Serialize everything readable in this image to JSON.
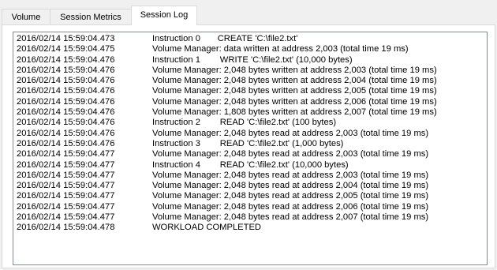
{
  "tabs": [
    "Volume",
    "Session Metrics",
    "Session Log"
  ],
  "active_tab": "Session Log",
  "log": [
    {
      "ts": "2016/02/14 15:59:04.473",
      "msg": "Instruction 0       CREATE 'C:\\file2.txt'"
    },
    {
      "ts": "2016/02/14 15:59:04.475",
      "msg": "Volume Manager: data written at address 2,003 (total time 19 ms)"
    },
    {
      "ts": "2016/02/14 15:59:04.476",
      "msg": "Instruction 1        WRITE 'C:\\file2.txt' (10,000 bytes)"
    },
    {
      "ts": "2016/02/14 15:59:04.476",
      "msg": "Volume Manager: 2,048 bytes written at address 2,003 (total time 19 ms)"
    },
    {
      "ts": "2016/02/14 15:59:04.476",
      "msg": "Volume Manager: 2,048 bytes written at address 2,004 (total time 19 ms)"
    },
    {
      "ts": "2016/02/14 15:59:04.476",
      "msg": "Volume Manager: 2,048 bytes written at address 2,005 (total time 19 ms)"
    },
    {
      "ts": "2016/02/14 15:59:04.476",
      "msg": "Volume Manager: 2,048 bytes written at address 2,006 (total time 19 ms)"
    },
    {
      "ts": "2016/02/14 15:59:04.476",
      "msg": "Volume Manager: 1,808 bytes written at address 2,007 (total time 19 ms)"
    },
    {
      "ts": "2016/02/14 15:59:04.476",
      "msg": "Instruction 2        READ 'C:\\file2.txt' (100 bytes)"
    },
    {
      "ts": "2016/02/14 15:59:04.476",
      "msg": "Volume Manager: 2,048 bytes read at address 2,003 (total time 19 ms)"
    },
    {
      "ts": "2016/02/14 15:59:04.476",
      "msg": "Instruction 3        READ 'C:\\file2.txt' (1,000 bytes)"
    },
    {
      "ts": "2016/02/14 15:59:04.477",
      "msg": "Volume Manager: 2,048 bytes read at address 2,003 (total time 19 ms)"
    },
    {
      "ts": "2016/02/14 15:59:04.477",
      "msg": "Instruction 4        READ 'C:\\file2.txt' (10,000 bytes)"
    },
    {
      "ts": "2016/02/14 15:59:04.477",
      "msg": "Volume Manager: 2,048 bytes read at address 2,003 (total time 19 ms)"
    },
    {
      "ts": "2016/02/14 15:59:04.477",
      "msg": "Volume Manager: 2,048 bytes read at address 2,004 (total time 19 ms)"
    },
    {
      "ts": "2016/02/14 15:59:04.477",
      "msg": "Volume Manager: 2,048 bytes read at address 2,005 (total time 19 ms)"
    },
    {
      "ts": "2016/02/14 15:59:04.477",
      "msg": "Volume Manager: 2,048 bytes read at address 2,006 (total time 19 ms)"
    },
    {
      "ts": "2016/02/14 15:59:04.477",
      "msg": "Volume Manager: 2,048 bytes read at address 2,007 (total time 19 ms)"
    },
    {
      "ts": "2016/02/14 15:59:04.478",
      "msg": "WORKLOAD COMPLETED"
    }
  ]
}
